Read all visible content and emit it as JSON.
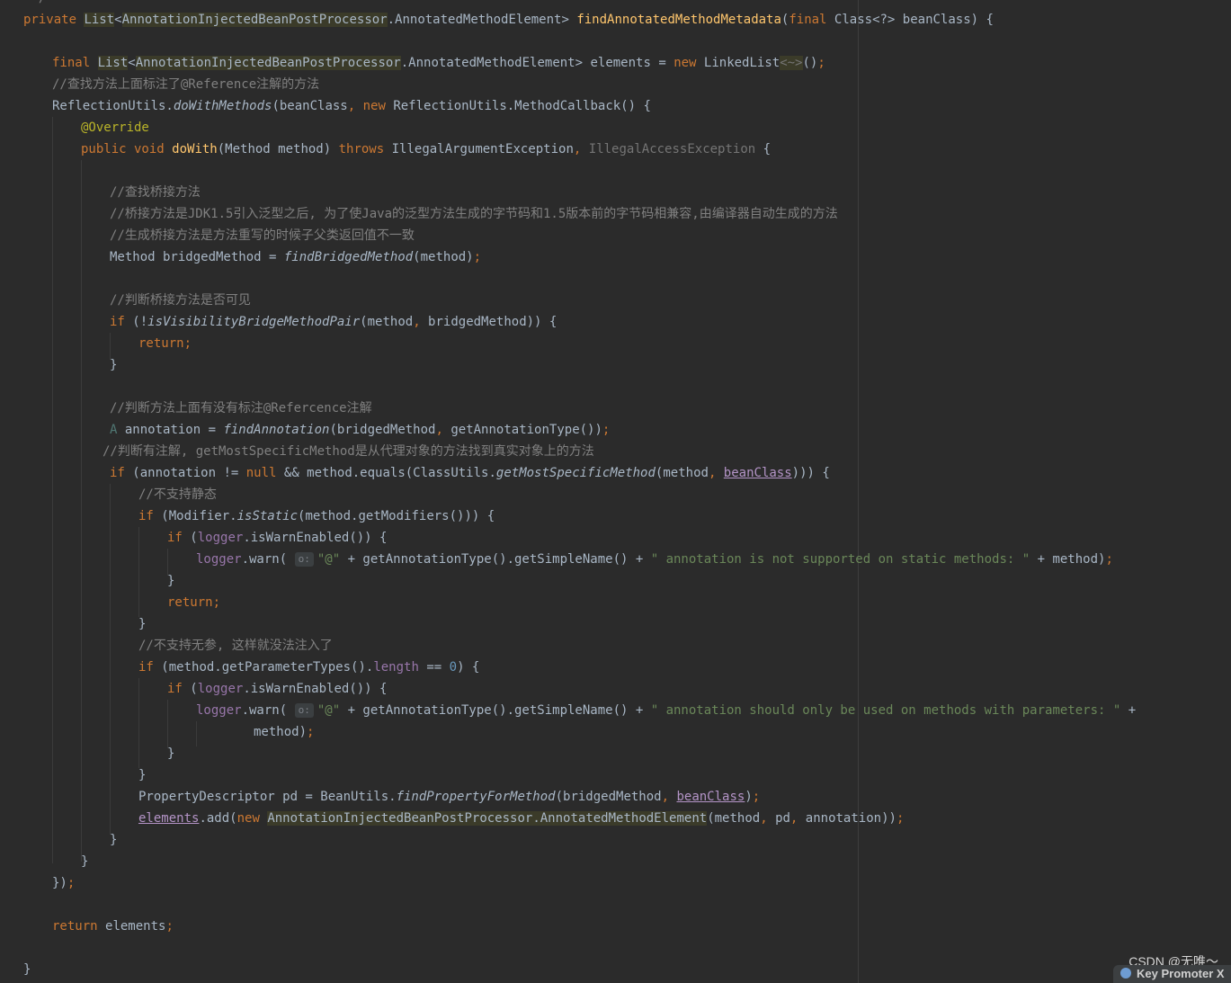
{
  "editor": {
    "comments": {
      "find_annotated": "//查找方法上面标注了@Reference注解的方法",
      "bridge_find": "//查找桥接方法",
      "bridge_desc": "//桥接方法是JDK1.5引入泛型之后, 为了使Java的泛型方法生成的字节码和1.5版本前的字节码相兼容,由编译器自动生成的方法",
      "bridge_gen": "//生成桥接方法是方法重写的时候子父类返回值不一致",
      "bridge_visible": "//判断桥接方法是否可见",
      "check_annotation": "//判断方法上面有没有标注@Refercence注解",
      "has_annotation": "//判断有注解, getMostSpecificMethod是从代理对象的方法找到真实对象上的方法",
      "no_static": "//不支持静态",
      "no_args": "//不支持无参, 这样就没法注入了"
    },
    "strings": {
      "at": "\"@\"",
      "static_msg": "\" annotation is not supported on static methods: \"",
      "params_msg": "\" annotation should only be used on methods with parameters: \""
    },
    "hint_label": "o:",
    "zero": "0"
  },
  "watermark": "CSDN @无唯～",
  "key_promoter": "Key Promoter X"
}
